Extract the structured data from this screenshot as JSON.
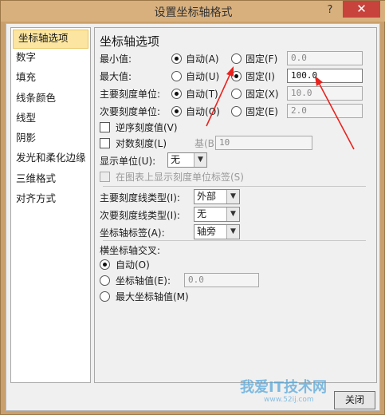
{
  "window": {
    "title": "设置坐标轴格式",
    "help": "?",
    "close": "✕"
  },
  "sidebar": {
    "items": [
      {
        "label": "坐标轴选项",
        "selected": true
      },
      {
        "label": "数字"
      },
      {
        "label": "填充"
      },
      {
        "label": "线条颜色"
      },
      {
        "label": "线型"
      },
      {
        "label": "阴影"
      },
      {
        "label": "发光和柔化边缘"
      },
      {
        "label": "三维格式"
      },
      {
        "label": "对齐方式"
      }
    ]
  },
  "axis": {
    "heading": "坐标轴选项",
    "auto": "自动",
    "min": {
      "label": "最小值:",
      "auto_key": "(A)",
      "fixed": "固定(F)",
      "value": "0.0"
    },
    "max": {
      "label": "最大值:",
      "auto_key": "(U)",
      "fixed": "固定(I)",
      "value": "100.0"
    },
    "major": {
      "label": "主要刻度单位:",
      "auto_key": "(T)",
      "fixed": "固定(X)",
      "value": "10.0"
    },
    "minor": {
      "label": "次要刻度单位:",
      "auto_key": "(O)",
      "fixed": "固定(E)",
      "value": "2.0"
    },
    "reverse": "逆序刻度值(V)",
    "log": "对数刻度(L)",
    "base_label": "基(B):",
    "base_value": "10",
    "display_units_label": "显示单位(U):",
    "display_units_value": "无",
    "show_units_label": "在图表上显示刻度单位标签(S)",
    "major_tick_label": "主要刻度线类型(I):",
    "major_tick_value": "外部",
    "minor_tick_label": "次要刻度线类型(I):",
    "minor_tick_value": "无",
    "tick_label_label": "坐标轴标签(A):",
    "tick_label_value": "轴旁",
    "cross_heading": "横坐标轴交叉:",
    "cross_auto": "自动(O)",
    "cross_value_label": "坐标轴值(E):",
    "cross_value": "0.0",
    "cross_max": "最大坐标轴值(M)"
  },
  "footer": {
    "close_label": "关闭"
  },
  "watermark": {
    "text": "我爱IT技术网",
    "url": "www.52ij.com"
  },
  "colors": {
    "annotation_arrow": "#e8231f",
    "selected_item": "#fce5a0"
  }
}
